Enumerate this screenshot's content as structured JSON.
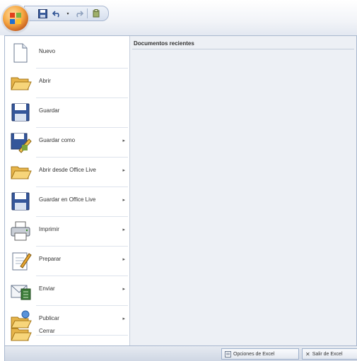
{
  "quick_access": {
    "icons": [
      "office-button-icon",
      "save-icon",
      "undo-icon",
      "redo-icon",
      "customize-icon"
    ]
  },
  "menu": {
    "items": [
      {
        "label": "Nuevo",
        "icon": "new-document-icon",
        "has_submenu": false
      },
      {
        "label": "Abrir",
        "icon": "open-folder-icon",
        "has_submenu": false
      },
      {
        "label": "Guardar",
        "icon": "save-icon",
        "has_submenu": false
      },
      {
        "label": "Guardar como",
        "icon": "save-as-icon",
        "has_submenu": true
      },
      {
        "label": "Abrir desde Office Live",
        "icon": "open-office-live-icon",
        "has_submenu": true
      },
      {
        "label": "Guardar en Office Live",
        "icon": "save-office-live-icon",
        "has_submenu": true
      },
      {
        "label": "Imprimir",
        "icon": "printer-icon",
        "has_submenu": true
      },
      {
        "label": "Preparar",
        "icon": "prepare-icon",
        "has_submenu": true
      },
      {
        "label": "Enviar",
        "icon": "send-icon",
        "has_submenu": true
      },
      {
        "label": "Publicar",
        "icon": "publish-icon",
        "has_submenu": true
      },
      {
        "label": "Cerrar",
        "icon": "close-folder-icon",
        "has_submenu": false
      }
    ],
    "submenu_arrow": "▸"
  },
  "recent": {
    "title": "Documentos recientes"
  },
  "footer": {
    "options_label": "Opciones de Excel",
    "exit_label": "Salir de Excel",
    "exit_glyph": "✕"
  }
}
